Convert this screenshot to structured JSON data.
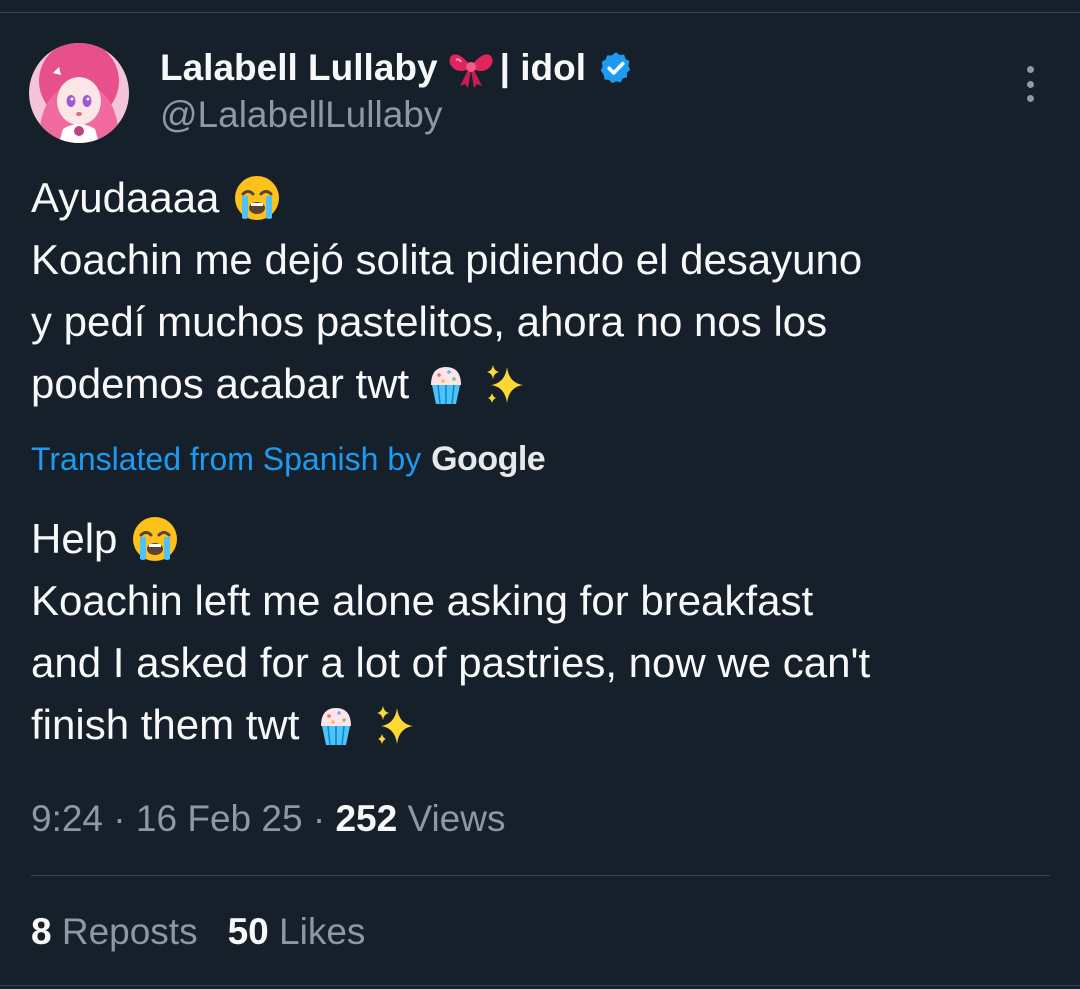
{
  "author": {
    "display_name": "Lalabell Lullaby",
    "name_suffix": "| idol",
    "handle": "@LalabellLullaby",
    "bow_icon": "ribbon-bow-emoji",
    "verified_icon": "verified-badge-icon",
    "verified_color": "#1d9bf0"
  },
  "original": {
    "line1": "Ayudaaaa",
    "line2": "Koachin me dejó solita pidiendo el desayuno",
    "line3": "y pedí muchos pastelitos, ahora no nos los",
    "line4": "podemos acabar twt"
  },
  "translation_note": {
    "text": "Translated from Spanish by",
    "provider": "Google"
  },
  "translated": {
    "line1": "Help",
    "line2": "Koachin left me alone asking for breakfast",
    "line3": "and I asked for a lot of pastries, now we can't",
    "line4": "finish them twt"
  },
  "meta": {
    "time": "9:24",
    "dot1": " · ",
    "date": "16 Feb 25",
    "dot2": " · ",
    "views_count": "252",
    "views_label": " Views"
  },
  "stats": {
    "reposts_count": "8",
    "reposts_label": " Reposts",
    "likes_count": "50",
    "likes_label": " Likes"
  },
  "colors": {
    "background": "#15202b",
    "primary_text": "#f7f9f9",
    "secondary_text": "#8b98a5",
    "link": "#1d9bf0",
    "divider": "#38444d"
  }
}
